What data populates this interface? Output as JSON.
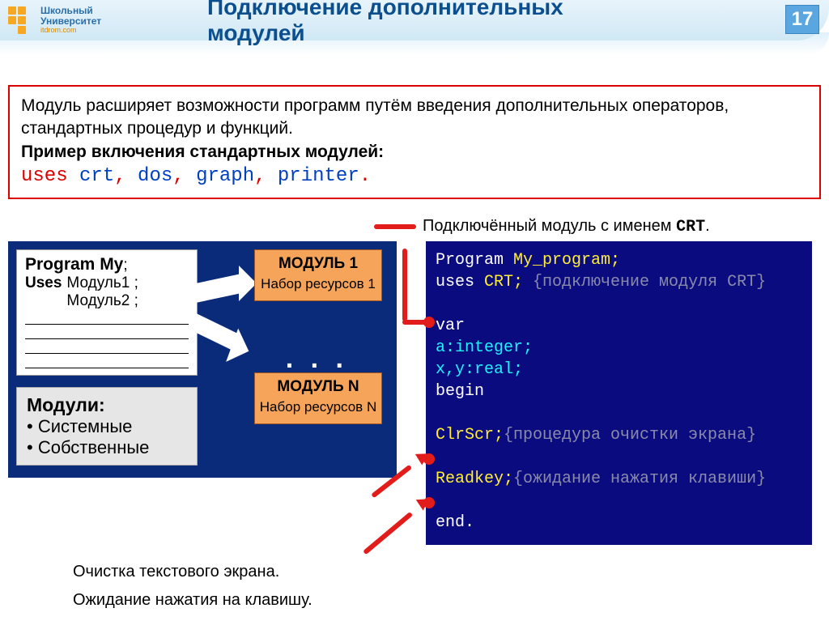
{
  "header": {
    "logo_top": "Школьный",
    "logo_bottom": "Университет",
    "logo_sub": "itdrom.com",
    "title": "Подключение дополнительных модулей",
    "page_number": "17"
  },
  "intro": {
    "line1": "Модуль расширяет возможности программ путём введения дополнительных операторов, стандартных процедур и функций.",
    "line2_bold": "Пример включения стандартных модулей:",
    "uses_kw": "uses",
    "mod1": "crt",
    "mod2": "dos",
    "mod3": "graph",
    "mod4": "printer",
    "comma": ",",
    "period": "."
  },
  "caption_top_pre": "Подключённый модуль с именем ",
  "caption_top_name": "CRT",
  "caption_top_post": ".",
  "diagram": {
    "prog_title": "Program My",
    "semicolon": ";",
    "uses_label": "Uses",
    "m1": "Модуль1 ;",
    "m2": "Модуль2 ;",
    "module1_title": "МОДУЛЬ 1",
    "module1_sub": "Набор ресурсов 1",
    "moduleN_title": "МОДУЛЬ N",
    "moduleN_sub": "Набор ресурсов N",
    "dots": ". . .",
    "types_title": "Модули:",
    "type1": "Системные",
    "type2": "Собственные"
  },
  "code": {
    "l1_kw": "Program",
    "l1_rest": " My_program;",
    "l2_kw": "uses",
    "l2_name": " CRT;",
    "l2_comment": " {подключение модуля CRT}",
    "l3_kw": "var",
    "l4": "    a:integer;",
    "l5": "    x,y:real;",
    "l6_kw": "begin",
    "l7_id": "ClrScr;",
    "l7_comment": "{процедура очистки экрана}",
    "l8_id": "Readkey;",
    "l8_comment": "{ожидание нажатия клавиши}",
    "l9_kw": "end."
  },
  "captions_below": {
    "c1": "Очистка текстового экрана.",
    "c2": "Ожидание нажатия на клавишу."
  }
}
